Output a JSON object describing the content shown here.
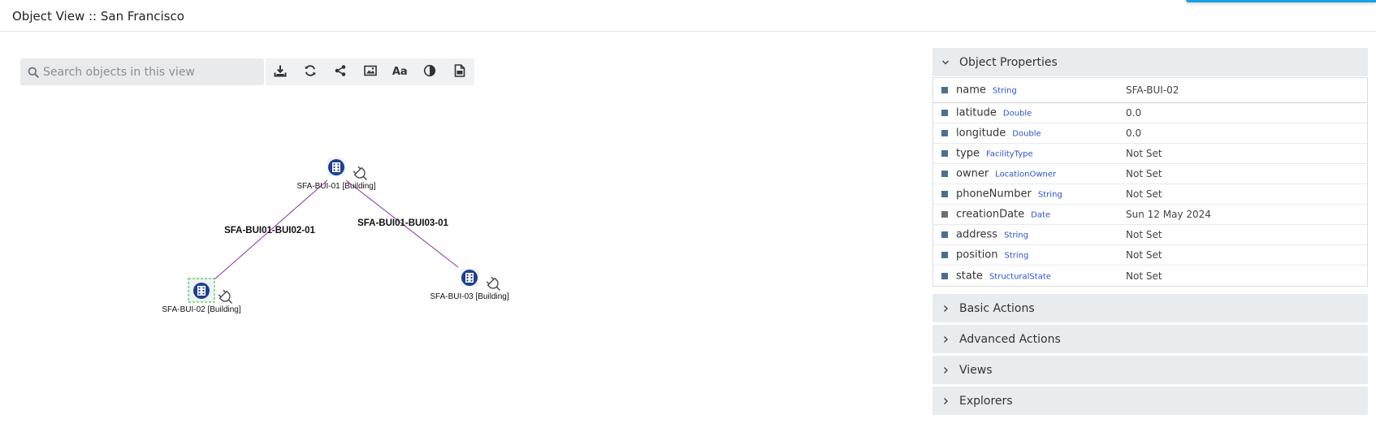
{
  "header": {
    "title": "Object View :: San Francisco"
  },
  "search": {
    "placeholder": "Search objects in this view",
    "value": ""
  },
  "toolbar": {
    "buttons": [
      {
        "name": "download-icon"
      },
      {
        "name": "refresh-icon"
      },
      {
        "name": "share-icon"
      },
      {
        "name": "image-icon"
      },
      {
        "name": "font-size-icon",
        "label": "Aa"
      },
      {
        "name": "contrast-icon"
      },
      {
        "name": "export-document-icon"
      }
    ]
  },
  "graph": {
    "nodes": [
      {
        "id": "n1",
        "label": "SFA-BUI-01 [Building]",
        "icon": "building-icon",
        "connector": "plug-icon"
      },
      {
        "id": "n2",
        "label": "SFA-BUI-02 [Building]",
        "icon": "building-icon",
        "connector": "plug-icon",
        "selected": true
      },
      {
        "id": "n3",
        "label": "SFA-BUI-03 [Building]",
        "icon": "building-icon",
        "connector": "plug-icon"
      }
    ],
    "edges": [
      {
        "from": "n1",
        "to": "n2",
        "label": "SFA-BUI01-BUI02-01"
      },
      {
        "from": "n1",
        "to": "n3",
        "label": "SFA-BUI01-BUI03-01"
      }
    ],
    "edge_color": "#8b2fa6",
    "node_color": "#1c3f8f",
    "selection_color": "#22c322"
  },
  "panel": {
    "object_properties": {
      "label": "Object Properties",
      "expanded": true,
      "properties": [
        {
          "name": "name",
          "type": "String",
          "value": "SFA-BUI-02"
        },
        {
          "name": "latitude",
          "type": "Double",
          "value": "0.0"
        },
        {
          "name": "longitude",
          "type": "Double",
          "value": "0.0"
        },
        {
          "name": "type",
          "type": "FacilityType",
          "value": "Not Set"
        },
        {
          "name": "owner",
          "type": "LocationOwner",
          "value": "Not Set"
        },
        {
          "name": "phoneNumber",
          "type": "String",
          "value": "Not Set"
        },
        {
          "name": "creationDate",
          "type": "Date",
          "value": "Sun 12 May 2024"
        },
        {
          "name": "address",
          "type": "String",
          "value": "Not Set"
        },
        {
          "name": "position",
          "type": "String",
          "value": "Not Set"
        },
        {
          "name": "state",
          "type": "StructuralState",
          "value": "Not Set"
        }
      ]
    },
    "sections": [
      {
        "label": "Basic Actions"
      },
      {
        "label": "Advanced Actions"
      },
      {
        "label": "Views"
      },
      {
        "label": "Explorers"
      }
    ]
  }
}
